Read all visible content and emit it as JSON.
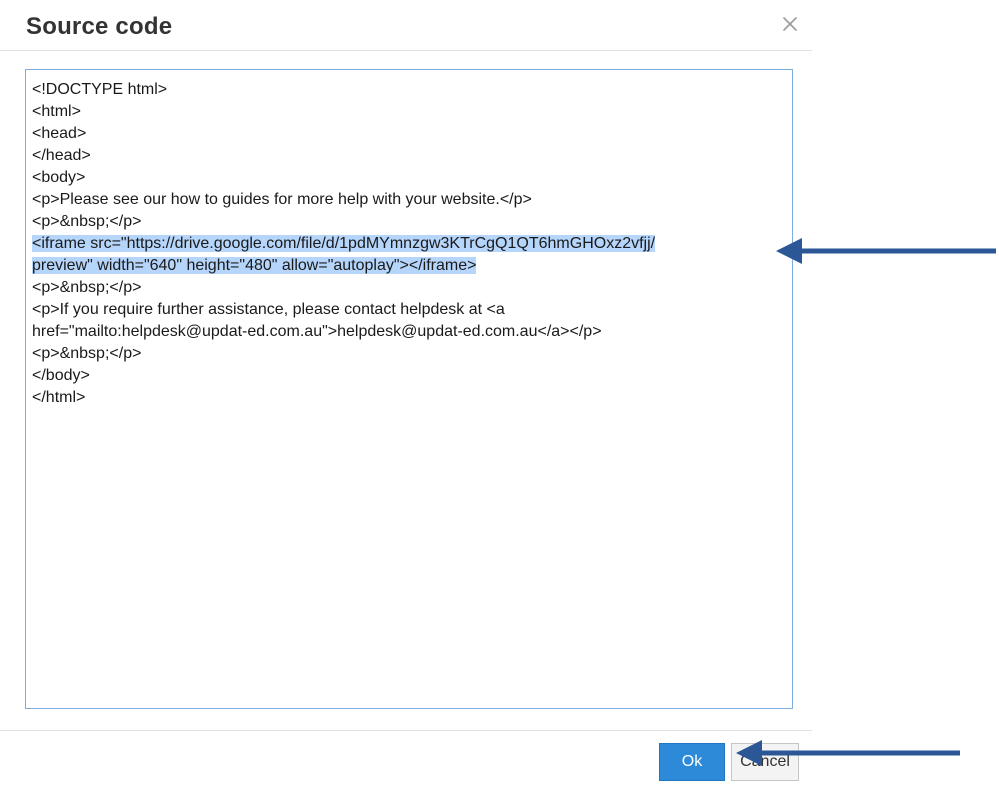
{
  "dialog": {
    "title": "Source code",
    "close_icon": "close-icon"
  },
  "source_code": {
    "lines": [
      {
        "text": "<!DOCTYPE html>",
        "selected": false
      },
      {
        "text": "<html>",
        "selected": false
      },
      {
        "text": "<head>",
        "selected": false
      },
      {
        "text": "</head>",
        "selected": false
      },
      {
        "text": "<body>",
        "selected": false
      },
      {
        "text": "<p>Please see our how to guides for more help with your website.</p>",
        "selected": false
      },
      {
        "text": "<p>&nbsp;</p>",
        "selected": false
      },
      {
        "text": "<iframe src=\"https://drive.google.com/file/d/1pdMYmnzgw3KTrCgQ1QT6hmGHOxz2vfjj/",
        "selected": true
      },
      {
        "text": "preview\" width=\"640\" height=\"480\" allow=\"autoplay\"></iframe>",
        "selected": true
      },
      {
        "text": "<p>&nbsp;</p>",
        "selected": false
      },
      {
        "text": "<p>If you require further assistance, please contact helpdesk at <a",
        "selected": false
      },
      {
        "text": "href=\"mailto:helpdesk@updat-ed.com.au\">helpdesk@updat-ed.com.au</a></p>",
        "selected": false
      },
      {
        "text": "<p>&nbsp;</p>",
        "selected": false
      },
      {
        "text": "</body>",
        "selected": false
      },
      {
        "text": "</html>",
        "selected": false
      }
    ]
  },
  "footer": {
    "ok_label": "Ok",
    "cancel_label": "Cancel"
  },
  "annotations": {
    "arrow_icon": "arrow-left-icon",
    "arrow_color": "#2b5797"
  },
  "colors": {
    "selection": "#b5d5fb",
    "primary_button": "#2d8ad8",
    "textarea_border": "#7eaee0"
  }
}
